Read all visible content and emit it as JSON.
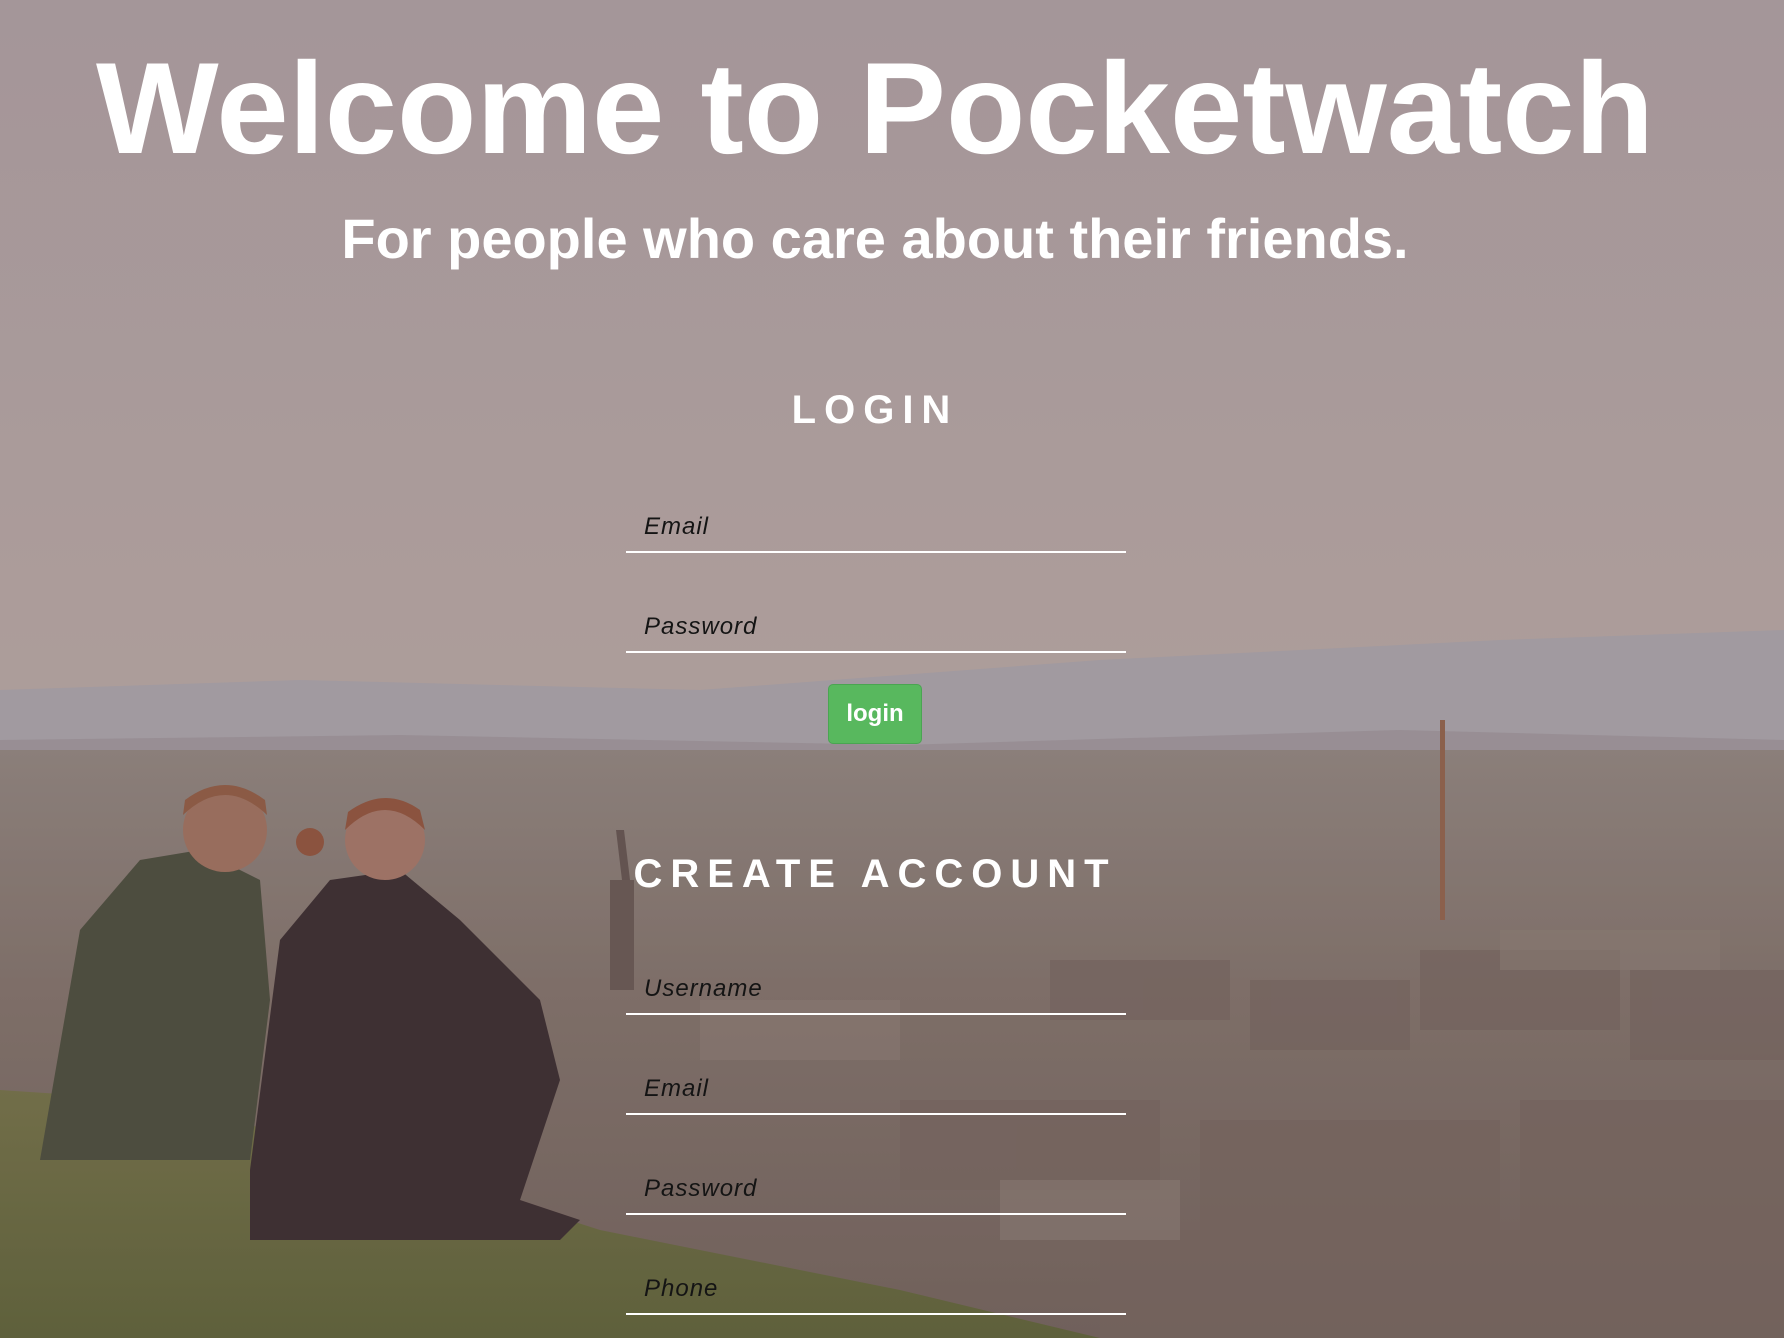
{
  "hero": {
    "title": "Welcome to Pocketwatch",
    "subtitle": "For people who care about their friends."
  },
  "login": {
    "heading": "LOGIN",
    "email_placeholder": "Email",
    "password_placeholder": "Password",
    "button_label": "login"
  },
  "create_account": {
    "heading": "CREATE ACCOUNT",
    "username_placeholder": "Username",
    "email_placeholder": "Email",
    "password_placeholder": "Password",
    "phone_placeholder": "Phone"
  },
  "colors": {
    "accent": "#58b85e",
    "text": "#ffffff"
  }
}
